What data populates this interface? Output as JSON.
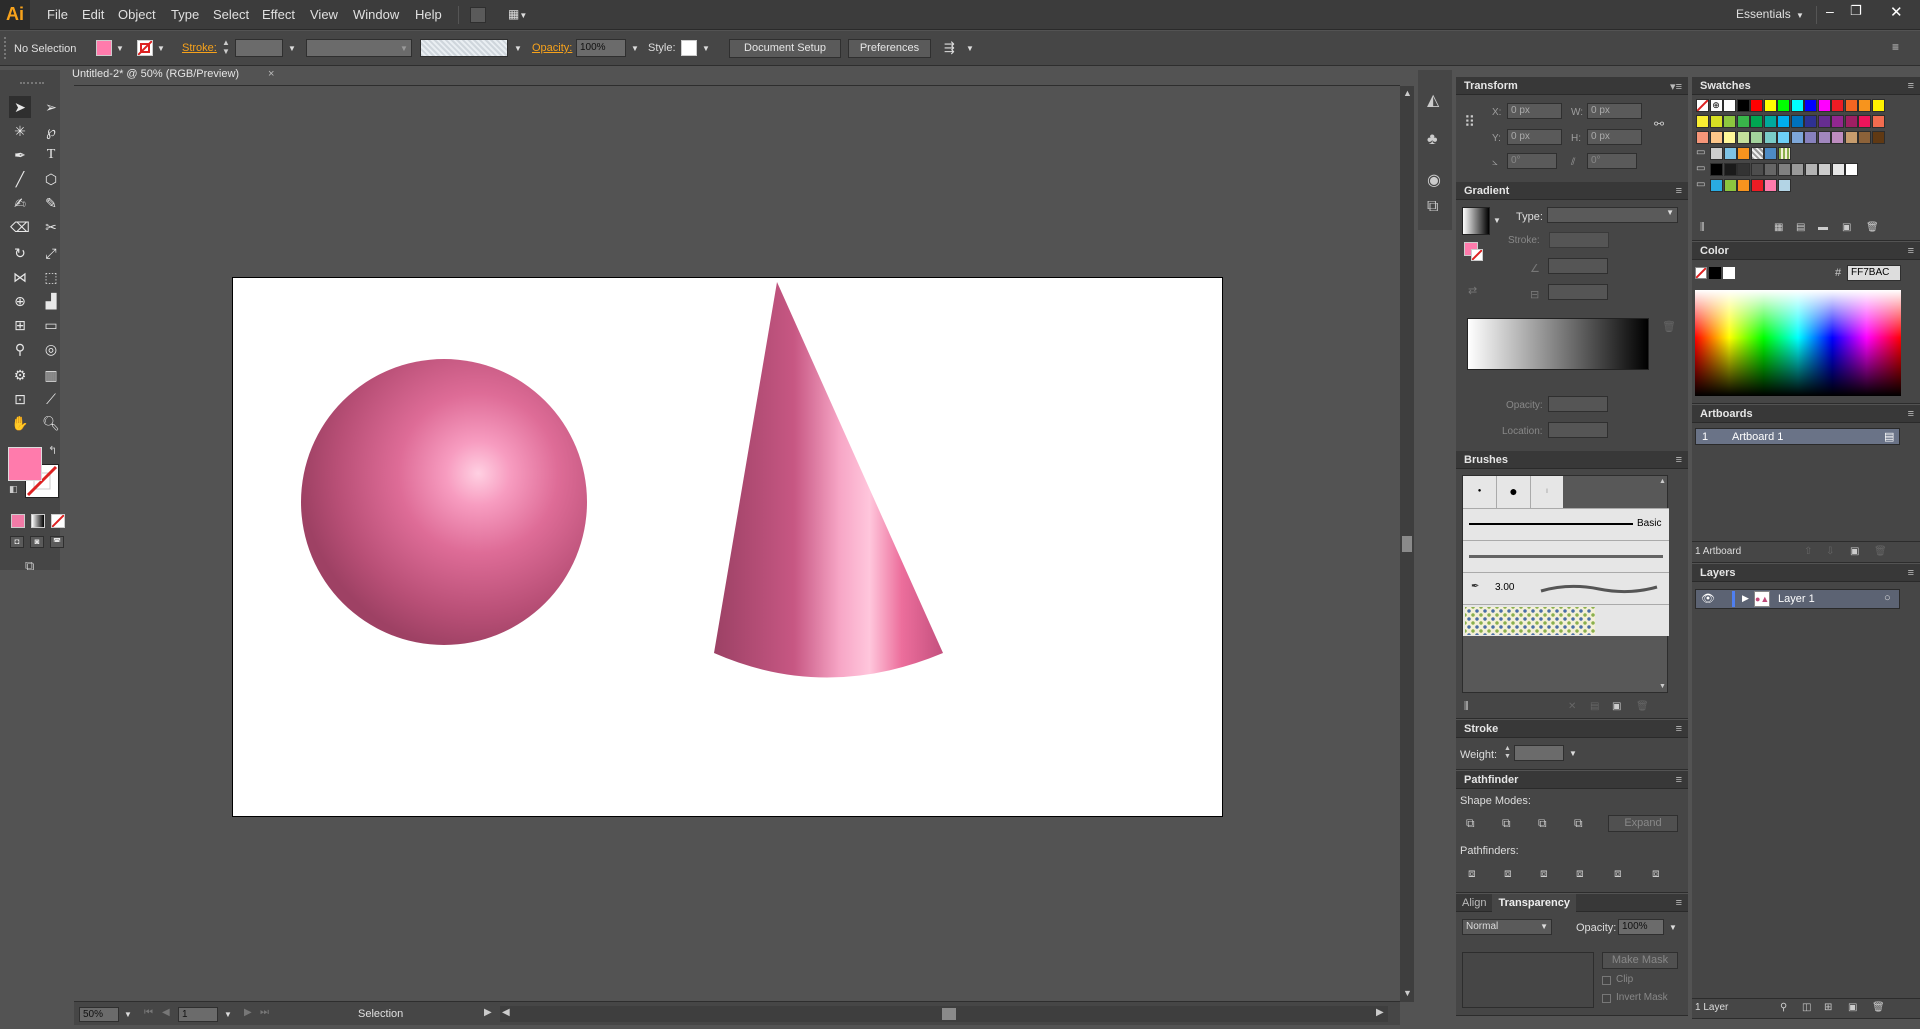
{
  "app": {
    "logo_text": "Ai",
    "workspace": "Essentials"
  },
  "menu": [
    "File",
    "Edit",
    "Object",
    "Type",
    "Select",
    "Effect",
    "View",
    "Window",
    "Help"
  ],
  "control_bar": {
    "selection_state": "No Selection",
    "fill_color": "#FF7BAC",
    "stroke_label": "Stroke:",
    "opacity_label": "Opacity:",
    "opacity_value": "100%",
    "style_label": "Style:",
    "document_setup": "Document Setup",
    "preferences": "Preferences"
  },
  "document": {
    "tab_title": "Untitled-2* @ 50% (RGB/Preview)",
    "zoom": "50%",
    "artboard_number": "1",
    "status_text": "Selection"
  },
  "artwork": {
    "sphere_color": "#D45B8A",
    "cone_color": "#E06A98"
  },
  "panels": {
    "transform": {
      "title": "Transform",
      "x_label": "X:",
      "x_value": "0 px",
      "y_label": "Y:",
      "y_value": "0 px",
      "w_label": "W:",
      "w_value": "0 px",
      "h_label": "H:",
      "h_value": "0 px",
      "rotate_value": "0°",
      "shear_value": "0°"
    },
    "gradient": {
      "title": "Gradient",
      "type_label": "Type:",
      "stroke_label": "Stroke:",
      "opacity_label": "Opacity:",
      "location_label": "Location:"
    },
    "brushes": {
      "title": "Brushes",
      "basic_label": "Basic",
      "size_label": "3.00"
    },
    "stroke": {
      "title": "Stroke",
      "weight_label": "Weight:"
    },
    "pathfinder": {
      "title": "Pathfinder",
      "shape_modes_label": "Shape Modes:",
      "pathfinders_label": "Pathfinders:",
      "expand_label": "Expand"
    },
    "align_tab": "Align",
    "transparency": {
      "title": "Transparency",
      "blend_mode": "Normal",
      "opacity_label": "Opacity:",
      "opacity_value": "100%",
      "make_mask": "Make Mask",
      "clip": "Clip",
      "invert_mask": "Invert Mask"
    },
    "swatches": {
      "title": "Swatches"
    },
    "color": {
      "title": "Color",
      "hash": "#",
      "hex_value": "FF7BAC"
    },
    "artboards": {
      "title": "Artboards",
      "rows": [
        {
          "index": "1",
          "name": "Artboard 1"
        }
      ],
      "footer": "1 Artboard"
    },
    "layers": {
      "title": "Layers",
      "rows": [
        {
          "name": "Layer 1"
        }
      ],
      "footer": "1 Layer"
    }
  }
}
